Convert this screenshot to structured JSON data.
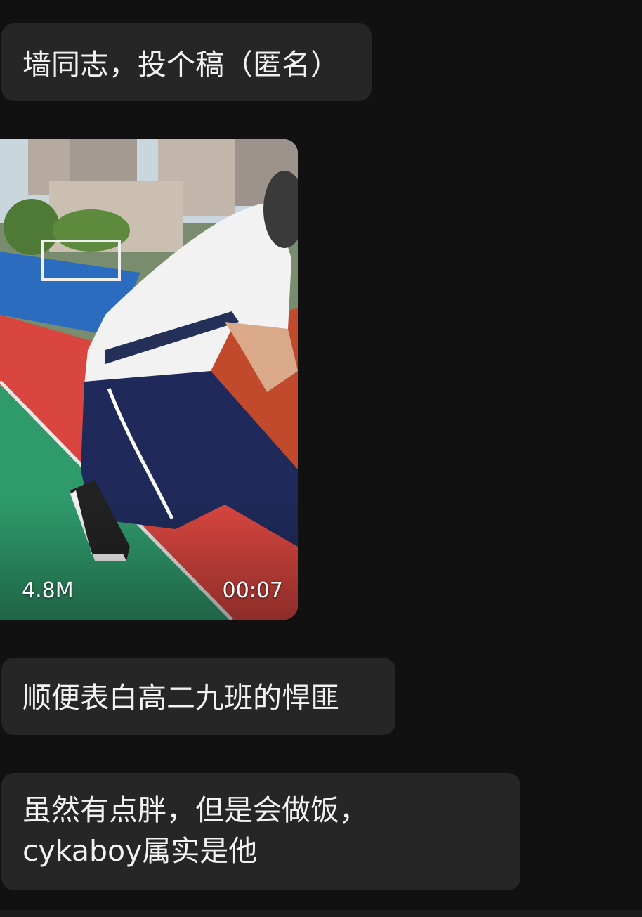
{
  "messages": {
    "m1": "墙同志，投个稿（匿名）",
    "m3": "顺便表白高二九班的悍匪",
    "m4": "虽然有点胖，但是会做饭，\ncykaboy属实是他"
  },
  "video": {
    "size": "4.8M",
    "duration": "00:07"
  },
  "colors": {
    "background": "#111111",
    "bubble": "#262626",
    "text": "#f2f2f2"
  }
}
